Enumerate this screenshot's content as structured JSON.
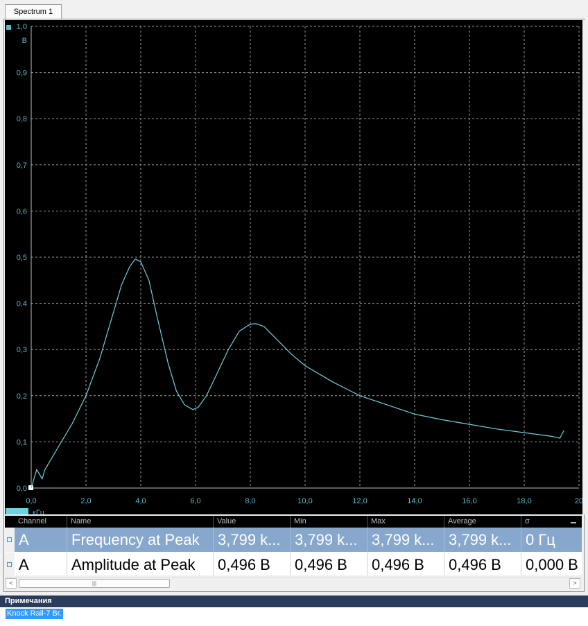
{
  "tab": {
    "label": "Spectrum 1"
  },
  "chart_data": {
    "type": "line",
    "ylabel": "В",
    "xlabel": "кГц",
    "xlim": [
      0,
      20
    ],
    "ylim": [
      0,
      1
    ],
    "x_ticks": [
      "0,0",
      "2,0",
      "4,0",
      "6,0",
      "8,0",
      "10,0",
      "12,0",
      "14,0",
      "16,0",
      "18,0",
      "20"
    ],
    "y_ticks": [
      "0,0",
      "0,1",
      "0,2",
      "0,3",
      "0,4",
      "0,5",
      "0,6",
      "0,7",
      "0,8",
      "0,9",
      "1,0"
    ],
    "grid": true,
    "colors": {
      "line": "#6fd0e0",
      "axis_text": "#5ab8c8",
      "background": "#000000",
      "grid": "#9a9a9a"
    },
    "series": [
      {
        "x": [
          0.0,
          0.2,
          0.4,
          0.5,
          1.0,
          1.5,
          2.0,
          2.5,
          3.0,
          3.3,
          3.6,
          3.8,
          4.0,
          4.3,
          4.6,
          5.0,
          5.3,
          5.6,
          5.9,
          6.1,
          6.4,
          6.8,
          7.2,
          7.6,
          8.0,
          8.2,
          8.5,
          9.0,
          9.5,
          10.0,
          11.0,
          12.0,
          13.0,
          14.0,
          15.0,
          16.0,
          17.0,
          18.0,
          19.0,
          19.3,
          19.45
        ],
        "y": [
          0.0,
          0.04,
          0.02,
          0.04,
          0.09,
          0.14,
          0.2,
          0.28,
          0.38,
          0.44,
          0.48,
          0.496,
          0.49,
          0.45,
          0.37,
          0.27,
          0.21,
          0.18,
          0.17,
          0.175,
          0.2,
          0.25,
          0.3,
          0.34,
          0.355,
          0.356,
          0.35,
          0.32,
          0.29,
          0.265,
          0.23,
          0.2,
          0.18,
          0.16,
          0.148,
          0.138,
          0.128,
          0.12,
          0.112,
          0.108,
          0.125
        ]
      }
    ]
  },
  "table": {
    "columns": [
      "Channel",
      "Name",
      "Value",
      "Min",
      "Max",
      "Average",
      "σ"
    ],
    "rows": [
      [
        "A",
        "Frequency at Peak",
        "3,799 k...",
        "3,799 k...",
        "3,799 k...",
        "3,799 k...",
        "0 Гц"
      ],
      [
        "A",
        "Amplitude at Peak",
        "0,496 В",
        "0,496 В",
        "0,496 В",
        "0,496 В",
        "0,000 В"
      ]
    ]
  },
  "scrollbar": {
    "left_arrow": "<",
    "right_arrow": ">",
    "thumb_grip": "|||"
  },
  "notes": {
    "title": "Примечания",
    "text": "Knock Rail-7 Br."
  }
}
